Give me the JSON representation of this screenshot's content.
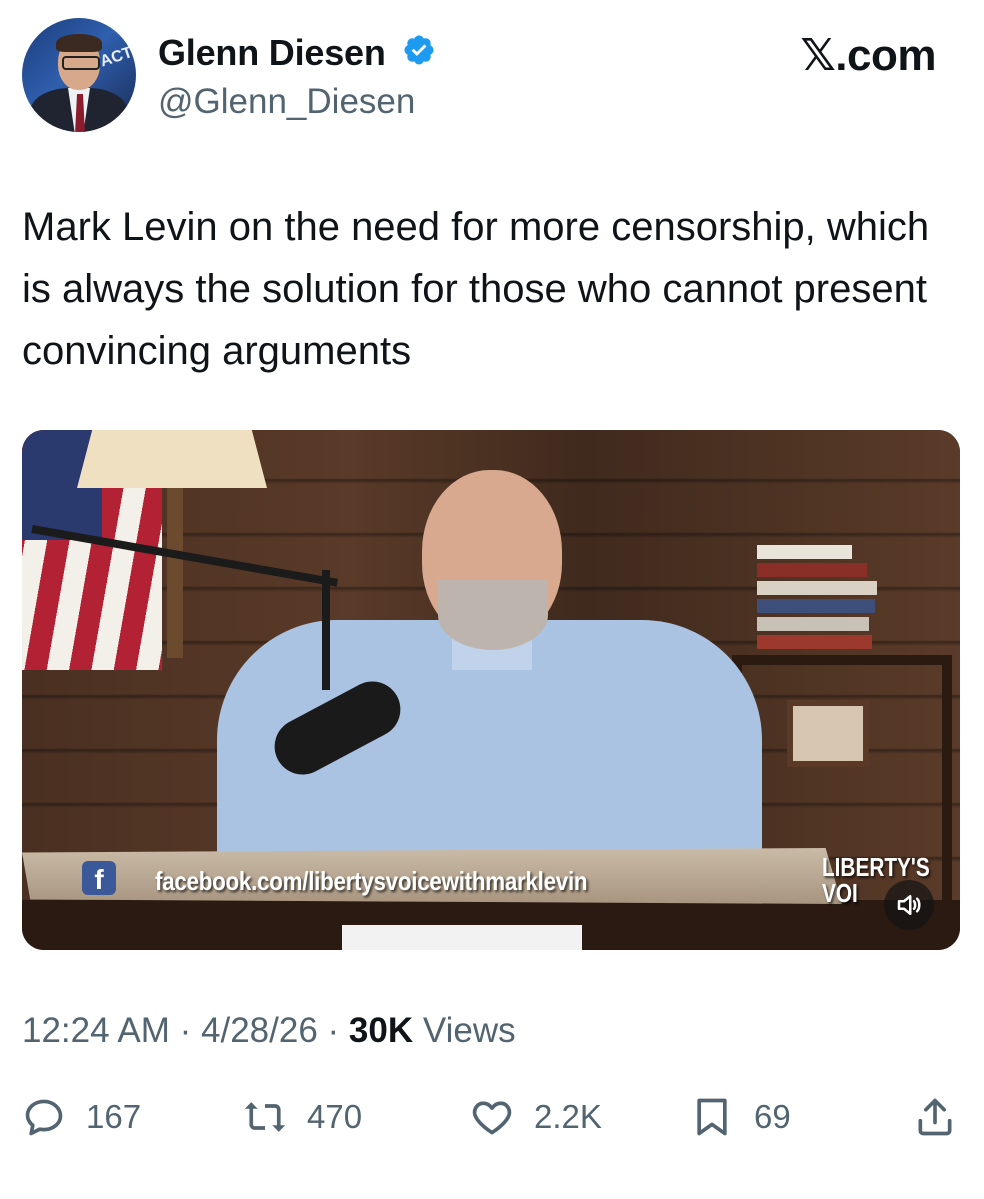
{
  "author": {
    "name": "Glenn Diesen",
    "handle": "@Glenn_Diesen",
    "avatar_backdrop_text": "ACTI",
    "verified": true,
    "verified_color": "#1d9bf0"
  },
  "brand": "𝕏.com",
  "tweet": {
    "text": "Mark Levin on the need for more censorship, which is always the solution for those who cannot present convincing arguments"
  },
  "media": {
    "banner_text": "facebook.com/libertysvoicewithmarklevin",
    "facebook_letter": "f",
    "logo_line1": "LIBERTY'S",
    "logo_line2": "VOI",
    "sound_icon": "speaker-icon"
  },
  "meta": {
    "time": "12:24 AM",
    "separator": "·",
    "date": "4/28/26",
    "views_count": "30K",
    "views_label": "Views"
  },
  "actions": {
    "replies": "167",
    "reposts": "470",
    "likes": "2.2K",
    "bookmarks": "69"
  },
  "colors": {
    "text": "#0f1419",
    "secondary": "#536471",
    "accent": "#1d9bf0"
  }
}
